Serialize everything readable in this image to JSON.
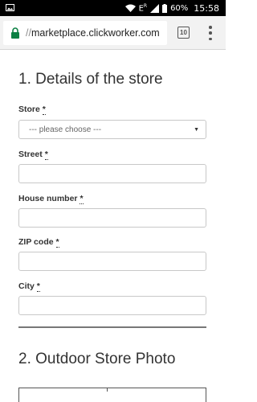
{
  "status_bar": {
    "battery_percent": "60%",
    "time": "15:58",
    "network_label": "E",
    "network_sub": "R"
  },
  "url_bar": {
    "scheme": "//",
    "host": "marketplace.clickworker.com",
    "tab_count": "10"
  },
  "sections": [
    {
      "title": "1. Details of the store"
    },
    {
      "title": "2. Outdoor Store Photo"
    }
  ],
  "fields": {
    "store": {
      "label": "Store",
      "required": "*",
      "selected": "--- please choose ---"
    },
    "street": {
      "label": "Street",
      "required": "*",
      "value": ""
    },
    "house_number": {
      "label": "House number",
      "required": "*",
      "value": ""
    },
    "zip": {
      "label": "ZIP code",
      "required": "*",
      "value": ""
    },
    "city": {
      "label": "City",
      "required": "*",
      "value": ""
    }
  },
  "icons": {
    "gallery": "image-icon",
    "lock": "lock-icon",
    "tabs": "tabs-icon",
    "menu": "more-vert-icon"
  },
  "colors": {
    "lock_green": "#0b8043",
    "status_bar": "#000000",
    "url_bar_bg": "#f2f2f2"
  }
}
